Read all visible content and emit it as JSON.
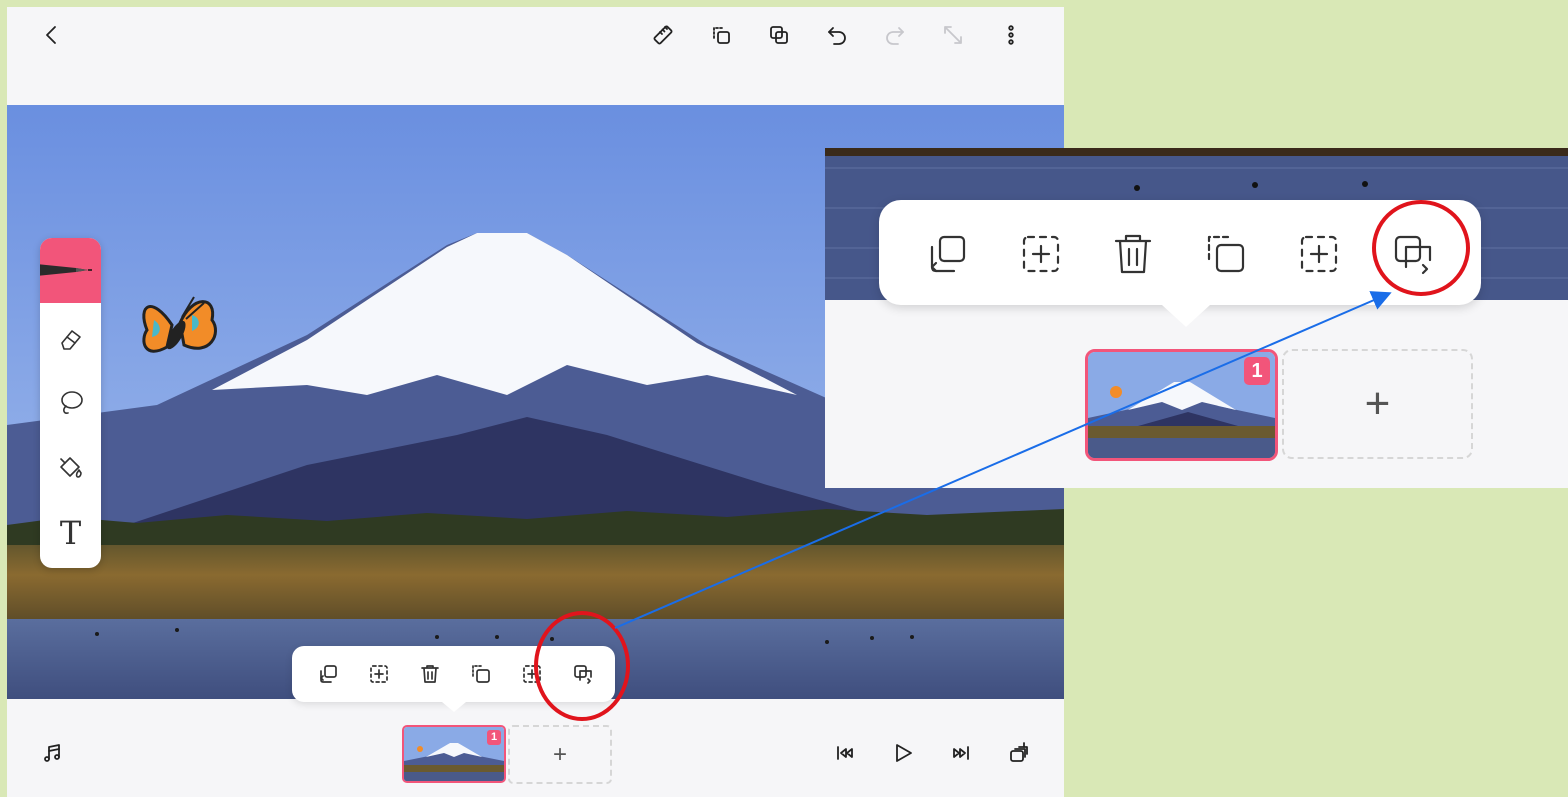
{
  "colors": {
    "background": "#d9e8b6",
    "accent": "#f2557a",
    "highlight_circle": "#e0141c",
    "arrow": "#1a6de8"
  },
  "topbar": {
    "left_icons": [
      "back-icon"
    ],
    "right_icons": [
      "ruler-icon",
      "copy-layer-icon",
      "duplicate-icon",
      "undo-icon",
      "redo-icon",
      "expand-icon",
      "more-vertical-icon"
    ]
  },
  "tool_palette": {
    "tools": [
      "pen-icon",
      "eraser-icon",
      "lasso-icon",
      "fill-bucket-icon",
      "text-tool-icon"
    ],
    "text_tool_glyph": "T"
  },
  "frame_toolbar": {
    "items": [
      "copy-frame-icon",
      "add-frame-dashed-icon",
      "delete-frame-icon",
      "duplicate-frame-icon",
      "insert-frame-dashed-icon",
      "copy-to-next-icon"
    ],
    "highlighted": "copy-to-next-icon"
  },
  "bottombar": {
    "left_icon": "music-icon",
    "frames": [
      {
        "number": "1",
        "selected": true
      }
    ],
    "add_frame_label": "+",
    "right_icons": [
      "skip-start-icon",
      "play-icon",
      "skip-end-icon",
      "onion-skin-icon"
    ]
  },
  "zoom_inset": {
    "frame_badge": "1",
    "add_frame_label": "+"
  }
}
